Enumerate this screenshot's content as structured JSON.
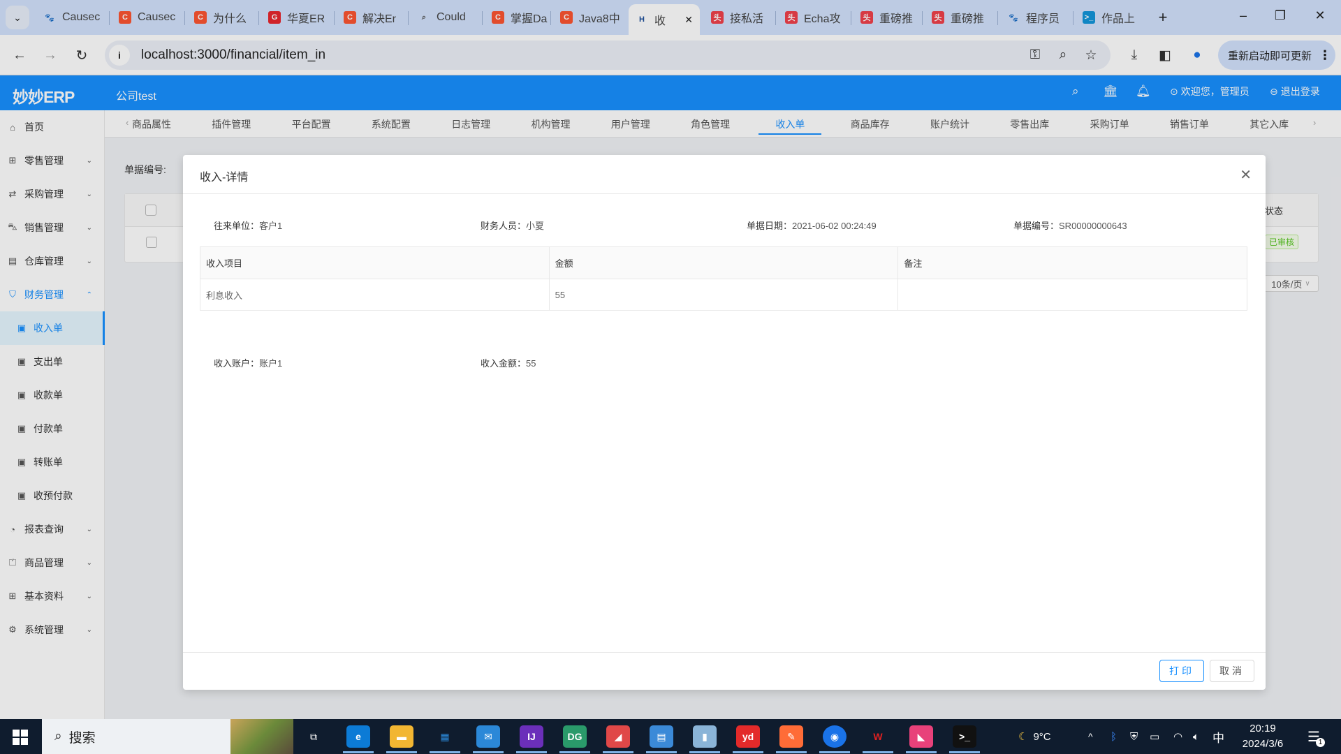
{
  "browser": {
    "tabs": [
      {
        "title": "Causec",
        "icon": "baidu-paw-icon",
        "color": "#2932e1"
      },
      {
        "title": "Causec",
        "icon": "csdn-c-icon",
        "color": "#fc5531"
      },
      {
        "title": "为什么",
        "icon": "csdn-c-icon",
        "color": "#fc5531"
      },
      {
        "title": "华夏ER",
        "icon": "huaxia-g-icon",
        "color": "#e8262d"
      },
      {
        "title": "解决Er",
        "icon": "csdn-c-icon",
        "color": "#fc5531"
      },
      {
        "title": "Could",
        "icon": "magnifier-icon",
        "color": "#555555"
      },
      {
        "title": "掌握Da",
        "icon": "csdn-c-icon",
        "color": "#fc5531"
      },
      {
        "title": "Java8中",
        "icon": "csdn-c-icon",
        "color": "#fc5531"
      },
      {
        "title": "收",
        "icon": "h-logo-icon",
        "color": "#1a4d9a",
        "active": true
      },
      {
        "title": "接私活",
        "icon": "toutiao-icon",
        "color": "#f0414b"
      },
      {
        "title": "Echa攻",
        "icon": "toutiao-icon",
        "color": "#f0414b"
      },
      {
        "title": "重磅推",
        "icon": "toutiao-icon",
        "color": "#f0414b"
      },
      {
        "title": "重磅推",
        "icon": "toutiao-icon",
        "color": "#f0414b"
      },
      {
        "title": "程序员",
        "icon": "baidu-paw-icon",
        "color": "#2932e1"
      },
      {
        "title": "作品上",
        "icon": "terminal-icon",
        "color": "#1296db"
      }
    ],
    "tab_glyphs": {
      "c": "C",
      "paw": "🐾",
      "g": "G",
      "mag": "⌕",
      "h": "H",
      "tt": "头",
      "term": ">_"
    },
    "url": "localhost:3000/financial/item_in",
    "update_label": "重新启动即可更新",
    "window_controls": {
      "minimize": "–",
      "maximize": "❐",
      "close": "✕"
    }
  },
  "app": {
    "logo": "妙妙ERP",
    "company": "公司test",
    "header": {
      "welcome": "欢迎您，管理员",
      "logout": "退出登录"
    },
    "nav_tabs": [
      "商品属性",
      "插件管理",
      "平台配置",
      "系统配置",
      "日志管理",
      "机构管理",
      "用户管理",
      "角色管理",
      "收入单",
      "商品库存",
      "账户统计",
      "零售出库",
      "采购订单",
      "销售订单",
      "其它入库"
    ],
    "active_nav_tab": "收入单",
    "sidebar": [
      {
        "label": "首页",
        "icon": "home-icon",
        "glyph": "⌂"
      },
      {
        "label": "零售管理",
        "icon": "gift-icon",
        "glyph": "⊞",
        "chevron": "⌄"
      },
      {
        "label": "采购管理",
        "icon": "swap-icon",
        "glyph": "⇄",
        "chevron": "⌄"
      },
      {
        "label": "销售管理",
        "icon": "cart-icon",
        "glyph": "⛍",
        "chevron": "⌄"
      },
      {
        "label": "仓库管理",
        "icon": "warehouse-icon",
        "glyph": "▤",
        "chevron": "⌄"
      },
      {
        "label": "财务管理",
        "icon": "finance-icon",
        "glyph": "⛉",
        "chevron": "⌃",
        "open": true
      },
      {
        "label": "收入单",
        "icon": "document-icon",
        "glyph": "▣",
        "sub": true,
        "selected": true
      },
      {
        "label": "支出单",
        "icon": "document-icon",
        "glyph": "▣",
        "sub": true
      },
      {
        "label": "收款单",
        "icon": "document-icon",
        "glyph": "▣",
        "sub": true
      },
      {
        "label": "付款单",
        "icon": "document-icon",
        "glyph": "▣",
        "sub": true
      },
      {
        "label": "转账单",
        "icon": "document-icon",
        "glyph": "▣",
        "sub": true
      },
      {
        "label": "收预付款",
        "icon": "document-icon",
        "glyph": "▣",
        "sub": true
      },
      {
        "label": "报表查询",
        "icon": "pie-chart-icon",
        "glyph": "◔",
        "chevron": "⌄"
      },
      {
        "label": "商品管理",
        "icon": "shopping-bag-icon",
        "glyph": "⏍",
        "chevron": "⌄"
      },
      {
        "label": "基本资料",
        "icon": "grid-icon",
        "glyph": "⊞",
        "chevron": "⌄"
      },
      {
        "label": "系统管理",
        "icon": "gear-icon",
        "glyph": "⚙",
        "chevron": "⌄"
      }
    ],
    "background_page": {
      "filter_label": "单据编号:",
      "status_header": "状态",
      "status_badge": "已审核",
      "page_size": "10条/页"
    }
  },
  "modal": {
    "title": "收入-详情",
    "fields": {
      "partner_label": "往来单位：",
      "partner": "客户1",
      "staff_label": "财务人员：",
      "staff": "小夏",
      "date_label": "单据日期：",
      "date": "2021-06-02 00:24:49",
      "number_label": "单据编号：",
      "number": "SR00000000643"
    },
    "table": {
      "columns": [
        "收入项目",
        "金额",
        "备注"
      ],
      "rows": [
        [
          "利息收入",
          "55",
          ""
        ]
      ]
    },
    "footer_fields": {
      "account_label": "收入账户：",
      "account": "账户1",
      "amount_label": "收入金额：",
      "amount": "55"
    },
    "print_label": "打印",
    "cancel_label": "取消"
  },
  "taskbar": {
    "search_label": "搜索",
    "weather": "9°C",
    "ime": "中",
    "time": "20:19",
    "date": "2024/3/6",
    "notification_count": "1"
  },
  "colors": {
    "primary": "#1890ff",
    "success": "#52c41a"
  }
}
